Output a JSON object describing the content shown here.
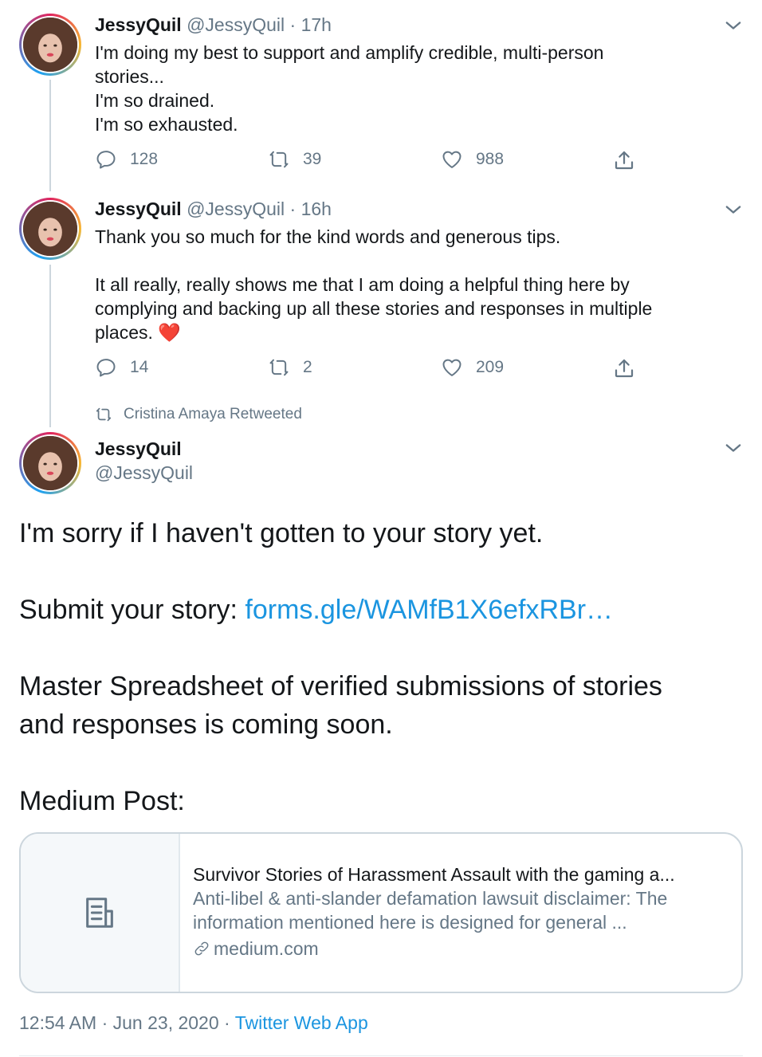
{
  "tweets": [
    {
      "name": "JessyQuil",
      "handle": "@JessyQuil",
      "separator": "·",
      "time": "17h",
      "lines": [
        "I'm doing my best to support and amplify credible, multi-person",
        "stories...",
        "I'm so drained.",
        "I'm so exhausted."
      ],
      "replies": "128",
      "retweets": "39",
      "likes": "988"
    },
    {
      "name": "JessyQuil",
      "handle": "@JessyQuil",
      "separator": "·",
      "time": "16h",
      "line1": "Thank you so much for the kind words and generous tips.",
      "line2": "It all really, really shows me that I am doing a helpful thing here by",
      "line3": "complying and backing up all these stories and responses in multiple",
      "line4": "places.",
      "emoji": "❤️",
      "replies": "14",
      "retweets": "2",
      "likes": "209"
    }
  ],
  "retweet_note": "Cristina Amaya Retweeted",
  "main_tweet": {
    "name": "JessyQuil",
    "handle": "@JessyQuil",
    "para1": "I'm sorry if I haven't gotten to your story yet.",
    "para2_prefix": "Submit your story: ",
    "para2_link": "forms.gle/WAMfB1X6efxRBr…",
    "para3_line1": "Master Spreadsheet of verified submissions of stories",
    "para3_line2": "and responses is coming soon.",
    "para4": "Medium Post:",
    "card": {
      "title": "Survivor Stories of Harassment Assault with the gaming a...",
      "desc_line1": "Anti-libel & anti-slander defamation lawsuit disclaimer: The",
      "desc_line2": "information mentioned here is designed for general ...",
      "domain": "medium.com"
    },
    "footer": {
      "time": "12:54 AM",
      "sep1": " · ",
      "date": "Jun 23, 2020",
      "sep2": " · ",
      "app": "Twitter Web App"
    }
  },
  "colors": {
    "text": "#14171a",
    "muted": "#657786",
    "link": "#1b95e0",
    "heart": "#e0245e",
    "border": "#ccd6dd"
  },
  "icons": [
    "reply-icon",
    "retweet-icon",
    "like-icon",
    "share-icon",
    "chevron-down-icon",
    "document-icon",
    "link-icon"
  ]
}
